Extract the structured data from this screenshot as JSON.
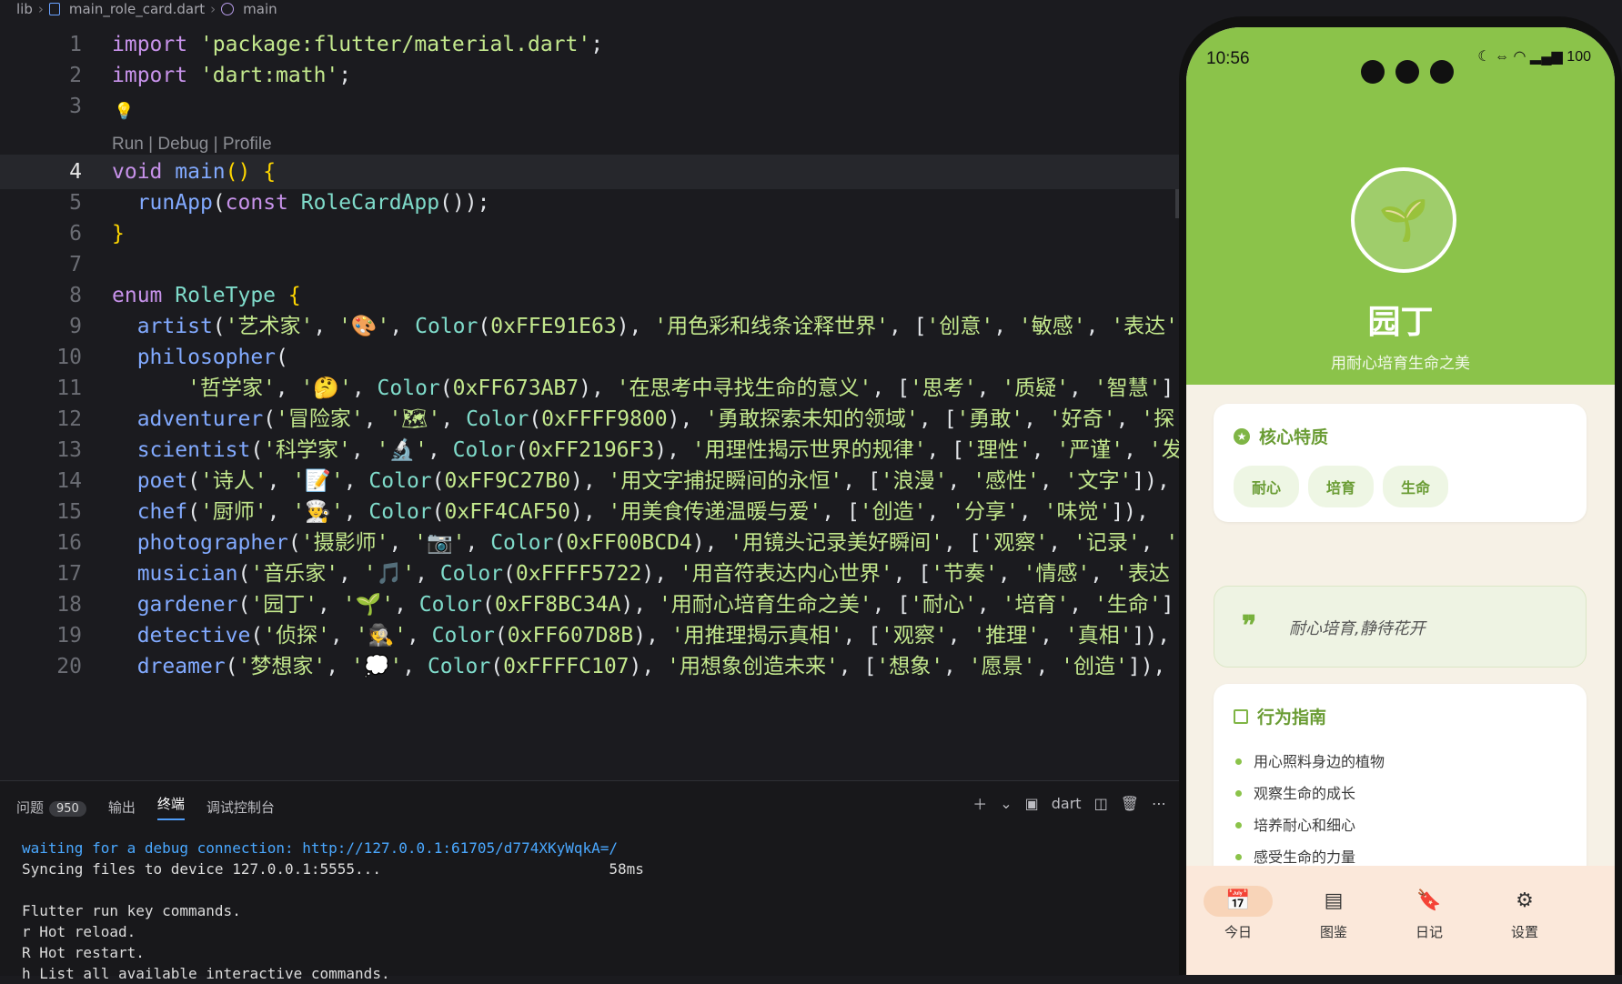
{
  "breadcrumb": {
    "folder": "lib",
    "file": "main_role_card.dart",
    "symbol": "main"
  },
  "editor": {
    "hint": "Run | Debug | Profile",
    "lines": [
      {
        "n": "1",
        "html": "<span class=\"kw\">import</span> <span class=\"str\">'package:flutter/material.dart'</span>;"
      },
      {
        "n": "2",
        "html": "<span class=\"kw\">import</span> <span class=\"str\">'dart:math'</span>;"
      },
      {
        "n": "3",
        "html": ""
      },
      {
        "n": "4",
        "html": "<span class=\"kw\">void</span> <span class=\"fn\">main</span><span class=\"brace\">()</span> <span class=\"brace\">{</span>"
      },
      {
        "n": "5",
        "html": "  <span class=\"fn\">runApp</span>(<span class=\"kw\">const</span> <span class=\"cls\">RoleCardApp</span>());"
      },
      {
        "n": "6",
        "html": "<span class=\"brace\">}</span>"
      },
      {
        "n": "7",
        "html": ""
      },
      {
        "n": "8",
        "html": "<span class=\"kw\">enum</span> <span class=\"cls\">RoleType</span> <span class=\"brace\">{</span>"
      },
      {
        "n": "9",
        "html": "  <span class=\"fn\">artist</span>(<span class=\"str\">'艺术家'</span>, <span class=\"str\">'🎨'</span>, <span class=\"cls\">Color</span>(<span class=\"str\">0xFFE91E63</span>), <span class=\"str\">'用色彩和线条诠释世界'</span>, [<span class=\"str\">'创意'</span>, <span class=\"str\">'敏感'</span>, <span class=\"str\">'表达'</span>"
      },
      {
        "n": "10",
        "html": "  <span class=\"fn\">philosopher</span>("
      },
      {
        "n": "11",
        "html": "      <span class=\"str\">'哲学家'</span>, <span class=\"str\">'🤔'</span>, <span class=\"cls\">Color</span>(<span class=\"str\">0xFF673AB7</span>), <span class=\"str\">'在思考中寻找生命的意义'</span>, [<span class=\"str\">'思考'</span>, <span class=\"str\">'质疑'</span>, <span class=\"str\">'智慧'</span>]"
      },
      {
        "n": "12",
        "html": "  <span class=\"fn\">adventurer</span>(<span class=\"str\">'冒险家'</span>, <span class=\"str\">'🗺'</span>, <span class=\"cls\">Color</span>(<span class=\"str\">0xFFFF9800</span>), <span class=\"str\">'勇敢探索未知的领域'</span>, [<span class=\"str\">'勇敢'</span>, <span class=\"str\">'好奇'</span>, <span class=\"str\">'探"
      },
      {
        "n": "13",
        "html": "  <span class=\"fn\">scientist</span>(<span class=\"str\">'科学家'</span>, <span class=\"str\">'🔬'</span>, <span class=\"cls\">Color</span>(<span class=\"str\">0xFF2196F3</span>), <span class=\"str\">'用理性揭示世界的规律'</span>, [<span class=\"str\">'理性'</span>, <span class=\"str\">'严谨'</span>, <span class=\"str\">'发"
      },
      {
        "n": "14",
        "html": "  <span class=\"fn\">poet</span>(<span class=\"str\">'诗人'</span>, <span class=\"str\">'📝'</span>, <span class=\"cls\">Color</span>(<span class=\"str\">0xFF9C27B0</span>), <span class=\"str\">'用文字捕捉瞬间的永恒'</span>, [<span class=\"str\">'浪漫'</span>, <span class=\"str\">'感性'</span>, <span class=\"str\">'文字'</span>]),"
      },
      {
        "n": "15",
        "html": "  <span class=\"fn\">chef</span>(<span class=\"str\">'厨师'</span>, <span class=\"str\">'👨‍🍳'</span>, <span class=\"cls\">Color</span>(<span class=\"str\">0xFF4CAF50</span>), <span class=\"str\">'用美食传递温暖与爱'</span>, [<span class=\"str\">'创造'</span>, <span class=\"str\">'分享'</span>, <span class=\"str\">'味觉'</span>]),"
      },
      {
        "n": "16",
        "html": "  <span class=\"fn\">photographer</span>(<span class=\"str\">'摄影师'</span>, <span class=\"str\">'📷'</span>, <span class=\"cls\">Color</span>(<span class=\"str\">0xFF00BCD4</span>), <span class=\"str\">'用镜头记录美好瞬间'</span>, [<span class=\"str\">'观察'</span>, <span class=\"str\">'记录'</span>, <span class=\"str\">'"
      },
      {
        "n": "17",
        "html": "  <span class=\"fn\">musician</span>(<span class=\"str\">'音乐家'</span>, <span class=\"str\">'🎵'</span>, <span class=\"cls\">Color</span>(<span class=\"str\">0xFFFF5722</span>), <span class=\"str\">'用音符表达内心世界'</span>, [<span class=\"str\">'节奏'</span>, <span class=\"str\">'情感'</span>, <span class=\"str\">'表达"
      },
      {
        "n": "18",
        "html": "  <span class=\"fn\">gardener</span>(<span class=\"str\">'园丁'</span>, <span class=\"str\">'🌱'</span>, <span class=\"cls\">Color</span>(<span class=\"str\">0xFF8BC34A</span>), <span class=\"str\">'用耐心培育生命之美'</span>, [<span class=\"str\">'耐心'</span>, <span class=\"str\">'培育'</span>, <span class=\"str\">'生命'</span>]"
      },
      {
        "n": "19",
        "html": "  <span class=\"fn\">detective</span>(<span class=\"str\">'侦探'</span>, <span class=\"str\">'🕵'</span>, <span class=\"cls\">Color</span>(<span class=\"str\">0xFF607D8B</span>), <span class=\"str\">'用推理揭示真相'</span>, [<span class=\"str\">'观察'</span>, <span class=\"str\">'推理'</span>, <span class=\"str\">'真相'</span>]),"
      },
      {
        "n": "20",
        "html": "  <span class=\"fn\">dreamer</span>(<span class=\"str\">'梦想家'</span>, <span class=\"str\">'💭'</span>, <span class=\"cls\">Color</span>(<span class=\"str\">0xFFFFC107</span>), <span class=\"str\">'用想象创造未来'</span>, [<span class=\"str\">'想象'</span>, <span class=\"str\">'愿景'</span>, <span class=\"str\">'创造'</span>]),"
      }
    ]
  },
  "panel": {
    "tabs": [
      {
        "label": "问题",
        "badge": "950"
      },
      {
        "label": "输出"
      },
      {
        "label": "终端",
        "active": true
      },
      {
        "label": "调试控制台"
      }
    ],
    "shell": "dart",
    "terminal": [
      {
        "text": "waiting for a debug connection: http://127.0.0.1:61705/d774XKyWqkA=/",
        "blue": true
      },
      {
        "text": "Syncing files to device 127.0.0.1:5555...                          58ms"
      },
      {
        "text": ""
      },
      {
        "text": "Flutter run key commands."
      },
      {
        "text": "r Hot reload."
      },
      {
        "text": "R Hot restart."
      },
      {
        "text": "h List all available interactive commands."
      }
    ]
  },
  "phone": {
    "time": "10:56",
    "battery": "100",
    "emoji": "🌱",
    "role_name": "园丁",
    "role_desc": "用耐心培育生命之美",
    "traits_title": "核心特质",
    "traits": [
      "耐心",
      "培育",
      "生命"
    ],
    "quote": "耐心培育,静待花开",
    "guide_title": "行为指南",
    "guide": [
      "用心照料身边的植物",
      "观察生命的成长",
      "培养耐心和细心",
      "感受生命的力量"
    ],
    "nav": [
      {
        "label": "今日",
        "icon": "calendar-icon",
        "active": true
      },
      {
        "label": "图鉴",
        "icon": "library-icon"
      },
      {
        "label": "日记",
        "icon": "bookmark-icon"
      },
      {
        "label": "设置",
        "icon": "gear-icon"
      }
    ],
    "accent": "#8BC34A"
  }
}
